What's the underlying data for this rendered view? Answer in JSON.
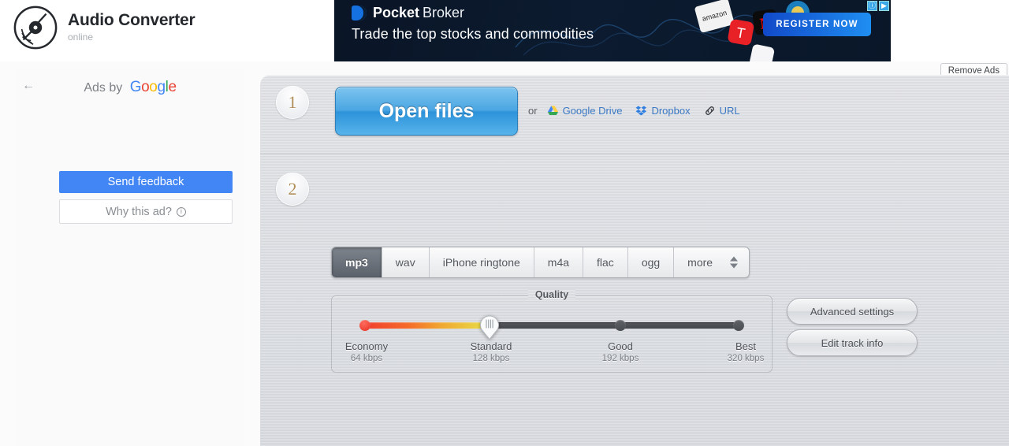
{
  "site": {
    "logo_icon": "vinyl-record-icon",
    "title": "Audio Converter",
    "subtitle": "online"
  },
  "banner_ad": {
    "brand_bold": "Pocket",
    "brand_light": "Broker",
    "tagline": "Trade the top stocks and commodities",
    "cta_label": "REGISTER NOW",
    "adchoices_icons": [
      "adchoices-icon",
      "info-icon"
    ],
    "background_color": "#0a1526",
    "cta_color": "#1f8ef1"
  },
  "remove_ads": {
    "label": "Remove Ads"
  },
  "ad_sidebar": {
    "back_icon": "arrow-left-icon",
    "ads_by_prefix": "Ads by",
    "ads_by_brand": "Google",
    "send_feedback_label": "Send feedback",
    "why_this_ad_label": "Why this ad?",
    "why_icon": "info-icon",
    "feedback_color": "#4285f4"
  },
  "app": {
    "step1": {
      "number": "1",
      "open_files_label": "Open files",
      "or_label": "or",
      "sources": [
        {
          "label": "Google Drive",
          "icon": "google-drive-icon"
        },
        {
          "label": "Dropbox",
          "icon": "dropbox-icon"
        },
        {
          "label": "URL",
          "icon": "link-icon"
        }
      ]
    },
    "step2": {
      "number": "2",
      "formats": [
        {
          "label": "mp3",
          "active": true
        },
        {
          "label": "wav",
          "active": false
        },
        {
          "label": "iPhone ringtone",
          "active": false
        },
        {
          "label": "m4a",
          "active": false
        },
        {
          "label": "flac",
          "active": false
        },
        {
          "label": "ogg",
          "active": false
        },
        {
          "label": "more",
          "active": false
        }
      ],
      "more_icon": "spinner-arrows-icon",
      "quality": {
        "legend": "Quality",
        "selected": "Standard",
        "levels": [
          {
            "name": "Economy",
            "rate": "64 kbps",
            "position": 0
          },
          {
            "name": "Standard",
            "rate": "128 kbps",
            "position": 33.4
          },
          {
            "name": "Good",
            "rate": "192 kbps",
            "position": 66.7
          },
          {
            "name": "Best",
            "rate": "320 kbps",
            "position": 100
          }
        ]
      },
      "advanced_settings_label": "Advanced settings",
      "edit_track_info_label": "Edit track info"
    }
  }
}
